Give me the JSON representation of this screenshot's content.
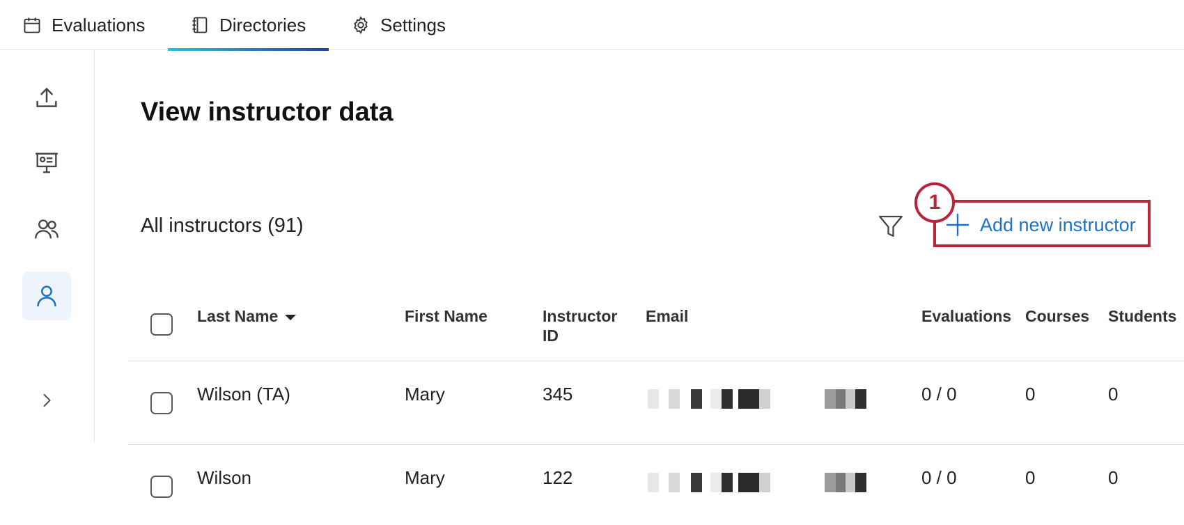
{
  "nav": {
    "tabs": [
      {
        "label": "Evaluations",
        "icon": "calendar-icon"
      },
      {
        "label": "Directories",
        "icon": "notebook-icon",
        "active": true
      },
      {
        "label": "Settings",
        "icon": "gear-icon"
      }
    ]
  },
  "rail": {
    "items": [
      {
        "icon": "upload-icon"
      },
      {
        "icon": "course-presentation-icon"
      },
      {
        "icon": "people-icon"
      },
      {
        "icon": "person-icon",
        "active": true
      },
      {
        "icon": "chevron-right-icon"
      }
    ]
  },
  "main": {
    "title": "View instructor data",
    "count_label": "All instructors (91)",
    "add_button_label": "Add new instructor",
    "step_number": "1"
  },
  "table": {
    "headers": {
      "last_name": "Last Name",
      "first_name": "First Name",
      "instructor_id_line1": "Instructor",
      "instructor_id_line2": "ID",
      "email": "Email",
      "evaluations": "Evaluations",
      "courses": "Courses",
      "students": "Students"
    },
    "rows": [
      {
        "last_name": "Wilson (TA)",
        "first_name": "Mary",
        "instructor_id": "345",
        "evaluations": "0 / 0",
        "courses": "0",
        "students": "0"
      },
      {
        "last_name": "Wilson",
        "first_name": "Mary",
        "instructor_id": "122",
        "evaluations": "0 / 0",
        "courses": "0",
        "students": "0"
      }
    ]
  },
  "colors": {
    "accent": "#1a73c9",
    "highlight": "#b8253b",
    "tab_gradient_start": "#22c3d3",
    "tab_gradient_end": "#2b3ea6"
  }
}
